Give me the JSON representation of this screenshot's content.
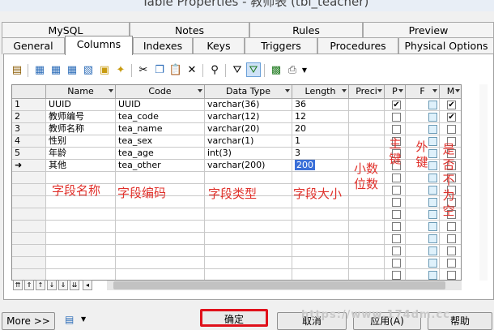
{
  "window": {
    "title": "Table Properties - 教师表 (tbl_teacher)"
  },
  "tabs_top": [
    "MySQL",
    "Notes",
    "Rules",
    "Preview"
  ],
  "tabs_bottom": [
    "General",
    "Columns",
    "Indexes",
    "Keys",
    "Triggers",
    "Procedures",
    "Physical Options"
  ],
  "active_tab": "Columns",
  "columns": {
    "headers": [
      "Name",
      "Code",
      "Data Type",
      "Length",
      "Preci",
      "P",
      "F",
      "M"
    ],
    "rows": [
      {
        "num": "1",
        "name": "UUID",
        "code": "UUID",
        "type": "varchar(36)",
        "length": "36",
        "p": true,
        "m": true
      },
      {
        "num": "2",
        "name": "教师编号",
        "code": "tea_code",
        "type": "varchar(12)",
        "length": "12",
        "p": false,
        "m": true
      },
      {
        "num": "3",
        "name": "教师名称",
        "code": "tea_name",
        "type": "varchar(20)",
        "length": "20",
        "p": false,
        "m": false
      },
      {
        "num": "4",
        "name": "性别",
        "code": "tea_sex",
        "type": "varchar(1)",
        "length": "1",
        "p": false,
        "m": false
      },
      {
        "num": "5",
        "name": "年龄",
        "code": "tea_age",
        "type": "int(3)",
        "length": "3",
        "p": false,
        "m": false
      },
      {
        "num": "➜",
        "name": "其他",
        "code": "tea_other",
        "type": "varchar(200)",
        "length": "200",
        "p": false,
        "m": false
      }
    ]
  },
  "annotations": {
    "name": "字段名称",
    "code": "字段编码",
    "type": "字段类型",
    "length": "字段大小",
    "precision": "小数位数",
    "primary": "主键",
    "foreign": "外键",
    "mandatory": "是否不为空"
  },
  "buttons": {
    "more": "More >>",
    "ok": "确定",
    "cancel": "取消",
    "apply": "应用(A)",
    "help": "帮助"
  },
  "watermark": "https://www.174dm.cc",
  "colors": {
    "annotation": "#e0302a",
    "ok_highlight": "#e0101a",
    "selection": "#3a6fd8"
  }
}
